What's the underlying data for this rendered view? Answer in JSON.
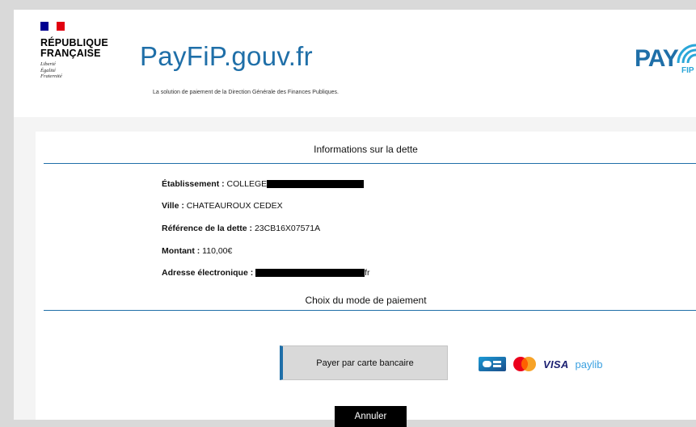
{
  "header": {
    "republique": "RÉPUBLIQUE\nFRANÇAISE",
    "motto": "Liberté\nÉgalité\nFraternité",
    "brand_main": "PayFiP",
    "brand_suffix": ".gouv.fr",
    "tagline": "La solution de paiement de la Direction Générale des Finances Publiques.",
    "logo_pay": "PAY",
    "logo_fip": "FIP"
  },
  "debt_section": {
    "title": "Informations sur la dette",
    "etablissement_label": "Établissement :",
    "etablissement_value": "COLLEGE",
    "ville_label": "Ville :",
    "ville_value": "CHATEAUROUX CEDEX",
    "reference_label": "Référence de la dette :",
    "reference_value": "23CB16X07571A",
    "montant_label": "Montant :",
    "montant_value": "110,00€",
    "email_label": "Adresse électronique :",
    "email_suffix": "fr"
  },
  "payment_section": {
    "title": "Choix du mode de paiement",
    "pay_card_button": "Payer par carte bancaire",
    "visa_label": "VISA",
    "paylib_label": "paylib",
    "cancel_button": "Annuler"
  },
  "colors": {
    "brand_blue": "#1f6fa8",
    "page_bg": "#d9d9d9",
    "button_bg": "#d9d9d9"
  }
}
